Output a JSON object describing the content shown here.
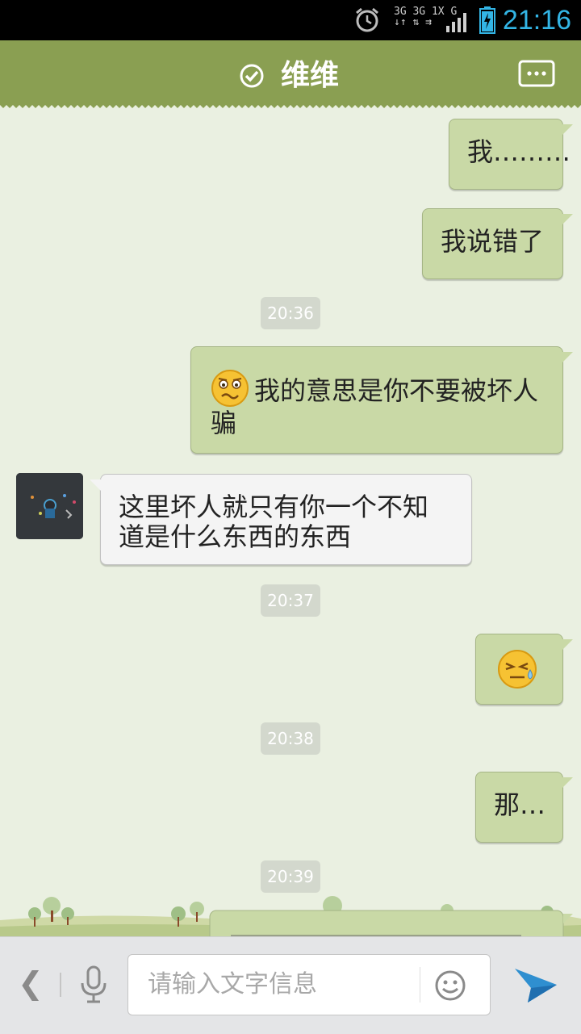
{
  "status_bar": {
    "time": "21:16",
    "network_line1": "3G 3G 1X G",
    "network_line2": "↓↑ ⇅ ⇉",
    "icons": [
      "alarm-icon",
      "signal-icon",
      "battery-charging-icon"
    ],
    "time_color": "#33b5e5"
  },
  "title_bar": {
    "title": "维维",
    "icons": [
      "verified-check-icon",
      "chat-menu-icon"
    ],
    "bg_color": "#8a9f52"
  },
  "messages": [
    {
      "direction": "out",
      "text": "我………"
    },
    {
      "direction": "out",
      "text": "我说错了"
    },
    {
      "type": "timestamp",
      "text": "20:36"
    },
    {
      "direction": "out",
      "emoji": "worried-face-icon",
      "text": "我的意思是你不要被坏人",
      "text_line2": "骗"
    },
    {
      "direction": "in",
      "text": "这里坏人就只有你一个不知",
      "text_line2": "道是什么东西的东西"
    },
    {
      "type": "timestamp",
      "text": "20:37"
    },
    {
      "direction": "out",
      "emoji": "sweat-face-icon"
    },
    {
      "type": "timestamp",
      "text": "20:38"
    },
    {
      "direction": "out",
      "text": "那…"
    },
    {
      "type": "timestamp",
      "text": "20:39"
    }
  ],
  "input_bar": {
    "placeholder": "请输入文字信息",
    "icons": [
      "back-arrow-icon",
      "microphone-icon",
      "emoji-icon",
      "send-icon"
    ]
  },
  "colors": {
    "outgoing_bubble": "#c9d9a6",
    "incoming_bubble": "#f4f4f4",
    "chat_background": "#eaf0e1"
  }
}
